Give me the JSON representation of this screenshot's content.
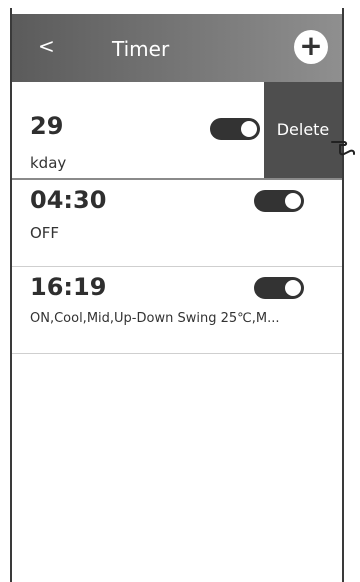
{
  "header": {
    "back_label": "<",
    "title": "Timer",
    "add_label": "+"
  },
  "timers": [
    {
      "time": "29",
      "sub": "kday",
      "toggle_on": true,
      "delete_label": "Delete"
    },
    {
      "time": "04:30",
      "sub": "OFF",
      "toggle_on": true
    },
    {
      "time": "16:19",
      "sub": "ON,Cool,Mid,Up-Down Swing 25℃,M...",
      "toggle_on": true
    }
  ]
}
